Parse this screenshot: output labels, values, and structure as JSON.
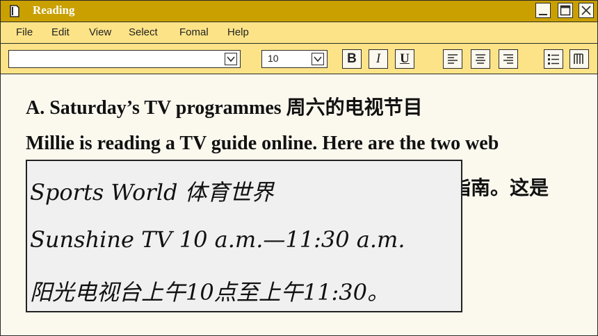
{
  "window": {
    "title": "Reading"
  },
  "menu": [
    "File",
    "Edit",
    "View",
    "Select",
    "Fomal",
    "Help"
  ],
  "toolbar": {
    "font_size": "10",
    "bold": "B",
    "italic": "I",
    "underline": "U"
  },
  "content": {
    "heading": "A. Saturday’s TV programmes 周六的电视节目",
    "line2": "Millie is reading a TV guide online. Here are the two web",
    "line3_visible": "指南。这是"
  },
  "overlay": {
    "line1": "Sports World 体育世界",
    "line2": "Sunshine TV 10 a.m.—11:30 a.m.",
    "line3": "阳光电视台上午10点至上午11:30。"
  }
}
